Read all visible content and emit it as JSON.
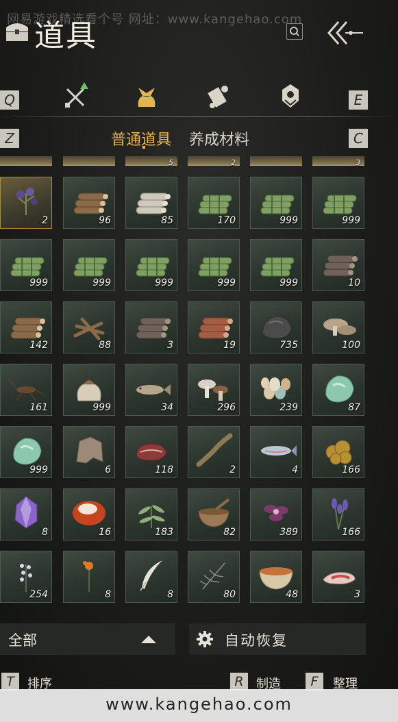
{
  "watermark": {
    "top_text": "网易游戏精选看个号  网址：www.kangehao.com",
    "bottom_url": "www.kangehao.com"
  },
  "header": {
    "title": "道具",
    "title_icon": "chest-icon",
    "search_icon": "search-icon",
    "back_icon": "back-arrows-icon"
  },
  "categories": {
    "left_key": "Q",
    "right_key": "E",
    "icons": [
      "weapons-icon",
      "items-bag-icon",
      "scroll-icon",
      "gem-icon"
    ],
    "active_index": 1,
    "accent_color": "#e2b552"
  },
  "tabs": {
    "left_key": "Z",
    "right_key": "C",
    "items": [
      {
        "label": "普通道具",
        "active": true
      },
      {
        "label": "养成材料",
        "active": false
      }
    ]
  },
  "grid": {
    "partial_row_counts": [
      "",
      "",
      "5",
      "2",
      "",
      "3"
    ],
    "rows": [
      [
        {
          "icon": "herb-icon",
          "count": "2",
          "gold": true
        },
        {
          "icon": "logs-icon",
          "count": "96"
        },
        {
          "icon": "birch-logs-icon",
          "count": "85"
        },
        {
          "icon": "bamboo-icon",
          "count": "170"
        },
        {
          "icon": "bamboo-icon",
          "count": "999"
        },
        {
          "icon": "bamboo-icon",
          "count": "999"
        }
      ],
      [
        {
          "icon": "bamboo-icon",
          "count": "999"
        },
        {
          "icon": "bamboo-icon",
          "count": "999"
        },
        {
          "icon": "bamboo-icon",
          "count": "999"
        },
        {
          "icon": "bamboo-icon",
          "count": "999"
        },
        {
          "icon": "bamboo-icon",
          "count": "999"
        },
        {
          "icon": "dark-logs-icon",
          "count": "10"
        }
      ],
      [
        {
          "icon": "logs-icon",
          "count": "142"
        },
        {
          "icon": "branches-icon",
          "count": "88"
        },
        {
          "icon": "dark-logs-icon",
          "count": "3"
        },
        {
          "icon": "red-logs-icon",
          "count": "19"
        },
        {
          "icon": "ore-icon",
          "count": "735"
        },
        {
          "icon": "mushroom-icon",
          "count": "100"
        }
      ],
      [
        {
          "icon": "cricket-icon",
          "count": "161"
        },
        {
          "icon": "grain-sack-icon",
          "count": "999"
        },
        {
          "icon": "fish-icon",
          "count": "34"
        },
        {
          "icon": "mushrooms-icon",
          "count": "296"
        },
        {
          "icon": "eggs-icon",
          "count": "239"
        },
        {
          "icon": "jade-icon",
          "count": "87"
        }
      ],
      [
        {
          "icon": "jade-icon",
          "count": "999"
        },
        {
          "icon": "fur-icon",
          "count": "6"
        },
        {
          "icon": "meat-icon",
          "count": "118"
        },
        {
          "icon": "eel-icon",
          "count": "2"
        },
        {
          "icon": "salmon-icon",
          "count": "4"
        },
        {
          "icon": "gold-ore-icon",
          "count": "166"
        }
      ],
      [
        {
          "icon": "amethyst-icon",
          "count": "8"
        },
        {
          "icon": "agate-icon",
          "count": "16"
        },
        {
          "icon": "leaf-herb-icon",
          "count": "183"
        },
        {
          "icon": "spice-bowl-icon",
          "count": "82"
        },
        {
          "icon": "purple-flower-icon",
          "count": "389"
        },
        {
          "icon": "lavender-icon",
          "count": "166"
        }
      ],
      [
        {
          "icon": "flower-sprig-icon",
          "count": "254"
        },
        {
          "icon": "orange-flower-icon",
          "count": "8"
        },
        {
          "icon": "feather-icon",
          "count": "8"
        },
        {
          "icon": "grass-icon",
          "count": "80"
        },
        {
          "icon": "soup-bowl-icon",
          "count": "48"
        },
        {
          "icon": "fish-fillet-icon",
          "count": "3"
        }
      ]
    ]
  },
  "bottom": {
    "filter_label": "全部",
    "filter_arrow_icon": "caret-up-icon",
    "auto_label": "自动恢复",
    "auto_icon": "gear-icon"
  },
  "footer": {
    "sort_key": "T",
    "sort_label": "排序",
    "craft_key": "R",
    "craft_label": "制造",
    "organize_key": "F",
    "organize_label": "整理"
  }
}
